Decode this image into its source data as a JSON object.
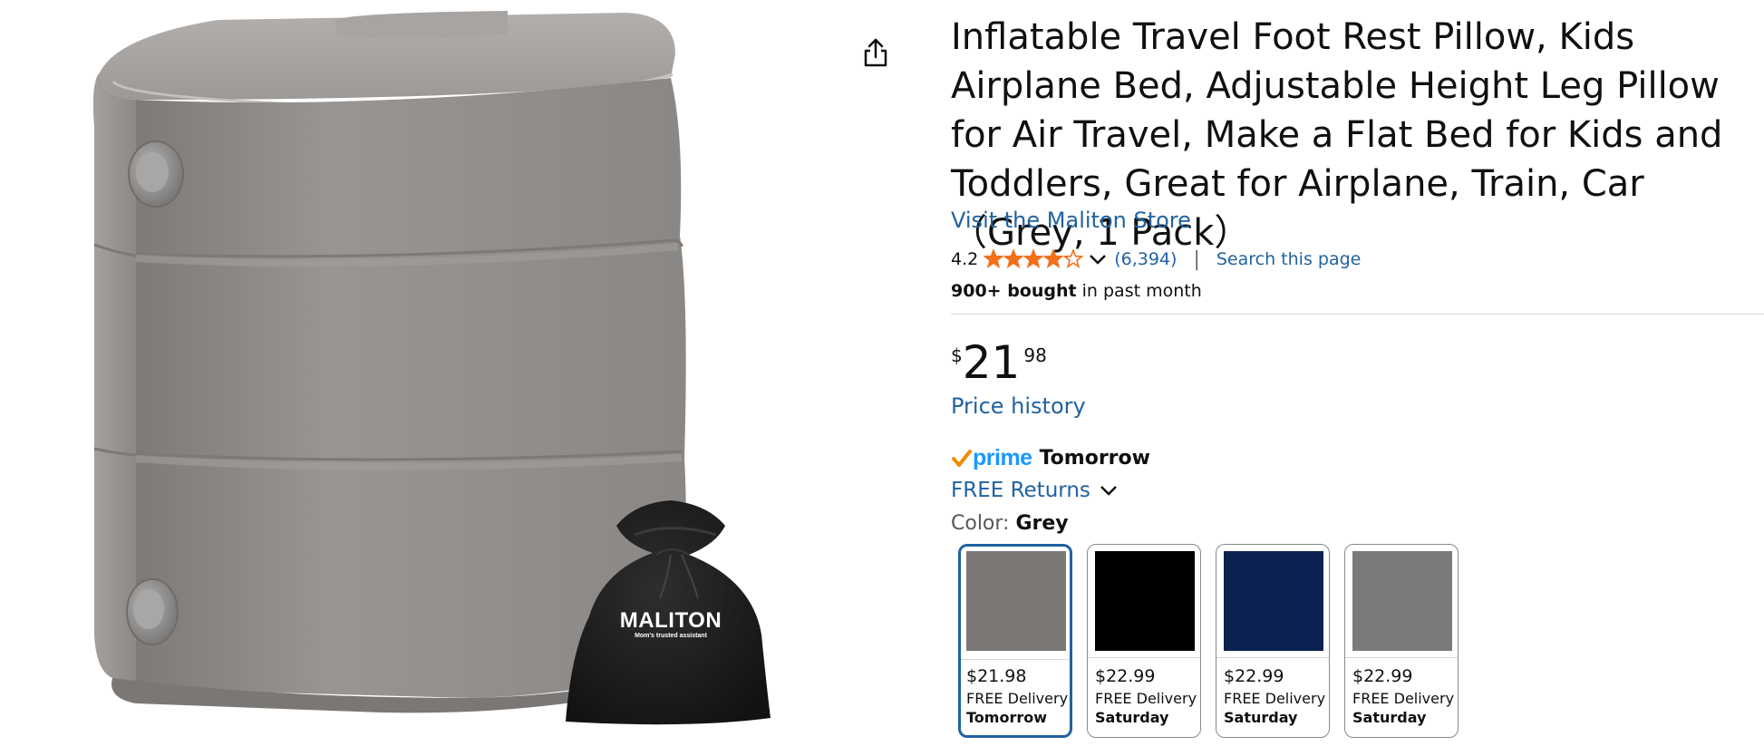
{
  "product": {
    "title": "Inflatable Travel Foot Rest Pillow, Kids Airplane Bed, Adjustable Height Leg Pillow for Air Travel, Make a Flat Bed for Kids and Toddlers, Great for Airplane, Train, Car（Grey, 1 Pack）",
    "store_link": "Visit the Maliton Store",
    "image": {
      "bag_brand": "MALITON",
      "bag_tagline": "Mom's trusted assistant"
    }
  },
  "rating": {
    "value": "4.2",
    "stars": 4.2,
    "count": "(6,394)",
    "divider": "|",
    "search_link": "Search this page"
  },
  "bought": {
    "bold": "900+ bought",
    "rest": " in past month"
  },
  "price": {
    "symbol": "$",
    "whole": "21",
    "fraction": "98",
    "history_link": "Price history"
  },
  "delivery": {
    "prime_label": "prime",
    "prime_day": "Tomorrow",
    "returns": "FREE Returns"
  },
  "color": {
    "label": "Color: ",
    "selected": "Grey",
    "options": [
      {
        "price": "$21.98",
        "delivery": "FREE Delivery",
        "day": "Tomorrow",
        "color": "#7b7875",
        "selected": true
      },
      {
        "price": "$22.99",
        "delivery": "FREE Delivery",
        "day": "Saturday",
        "color": "#000000",
        "selected": false
      },
      {
        "price": "$22.99",
        "delivery": "FREE Delivery",
        "day": "Saturday",
        "color": "#0b2150",
        "selected": false
      },
      {
        "price": "$22.99",
        "delivery": "FREE Delivery",
        "day": "Saturday",
        "color": "#7a7a7a",
        "selected": false
      }
    ]
  },
  "colors": {
    "link": "#2162a1",
    "star": "#f3701b",
    "prime_blue": "#1a98ff",
    "prime_check": "#f48a00",
    "pillow": "#8f8c8a",
    "bag": "#1c1c1c"
  },
  "icons": {
    "share": "share-icon",
    "dropdown": "chevron-down-icon",
    "prime_check": "check-icon"
  }
}
